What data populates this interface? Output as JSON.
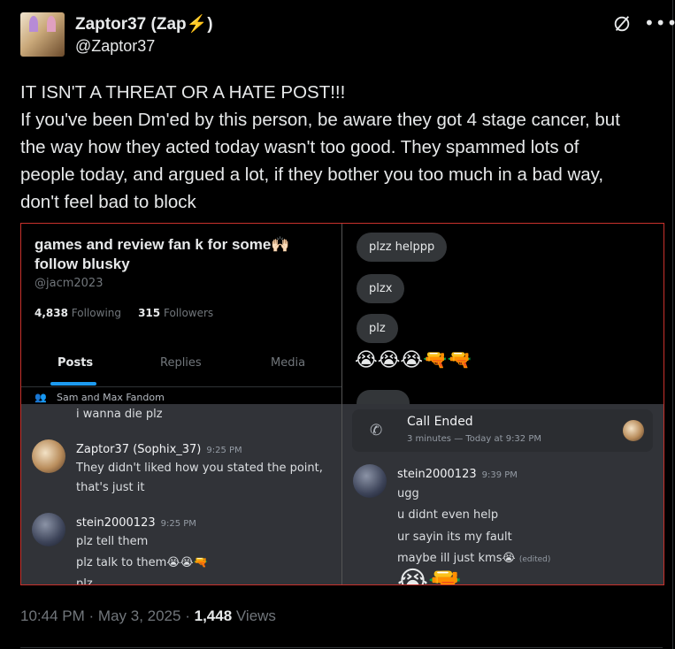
{
  "author": {
    "display_name": "Zaptor37 (Zap",
    "display_emoji": "⚡",
    "display_suffix": ")",
    "handle": "@Zaptor37"
  },
  "post": {
    "lines": [
      "IT ISN'T A THREAT OR A HATE POST!!!",
      "If you've been Dm'ed by this person, be aware they got 4 stage cancer, but",
      "the way how they acted today wasn't too good. They spammed lots of",
      "people today, and argued a lot, if they bother you too much in a bad way,",
      "don't feel bad to block"
    ]
  },
  "media": {
    "profile": {
      "name_line1": "games and review fan k for some🙌🏻",
      "name_line2": "follow blusky",
      "handle": "@jacm2023",
      "following_count": "4,838",
      "following_label": "Following",
      "followers_count": "315",
      "followers_label": "Followers",
      "tabs": [
        "Posts",
        "Replies",
        "Media"
      ],
      "fandom": "Sam and Max Fandom"
    },
    "dm": {
      "bubbles": [
        "plzz helppp",
        "plzx",
        "plz"
      ],
      "emojis": "😭😭😭🔫🔫"
    },
    "discord_left": {
      "top_line": "i wanna die plz",
      "msg1": {
        "name": "Zaptor37 (Sophix_37)",
        "time": "9:25 PM",
        "lines": [
          "They didn't liked how you stated the point,",
          "that's just it"
        ]
      },
      "msg2": {
        "name": "stein2000123",
        "time": "9:25 PM",
        "lines": [
          "plz tell them",
          "plz talk to them😭😭🔫",
          "plz"
        ]
      }
    },
    "discord_right": {
      "call_title": "Call Ended",
      "call_sub": "3 minutes — Today at 9:32 PM",
      "msg": {
        "name": "stein2000123",
        "time": "9:39 PM",
        "lines": [
          "ugg",
          "u didnt even help",
          "ur sayin its my fault",
          "maybe ill just kms😭"
        ],
        "edited": "(edited)"
      },
      "bottom_emojis": "😭🔫"
    }
  },
  "meta": {
    "time": "10:44 PM",
    "sep1": "·",
    "date": "May 3, 2025",
    "sep2": "·",
    "views_count": "1,448",
    "views_label": "Views"
  },
  "icons": [
    "grok-icon",
    "more-icon",
    "phone-icon",
    "people-icon"
  ]
}
